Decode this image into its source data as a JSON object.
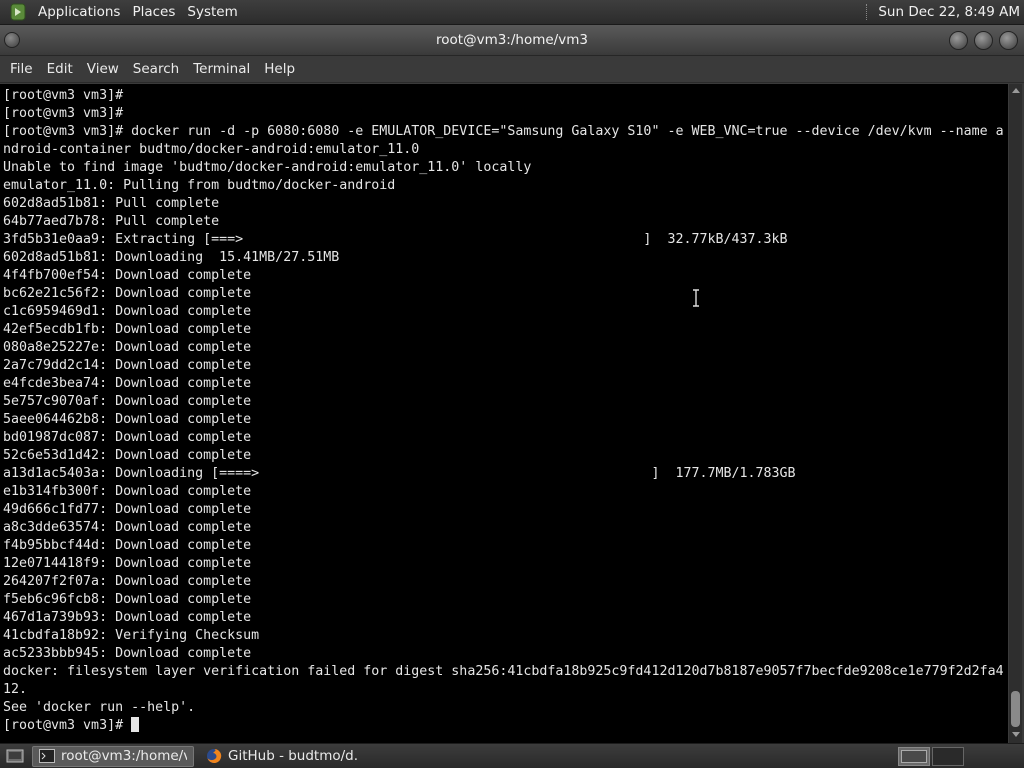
{
  "top_panel": {
    "menus": [
      "Applications",
      "Places",
      "System"
    ],
    "clock": "Sun Dec 22,  8:49 AM"
  },
  "window": {
    "title": "root@vm3:/home/vm3"
  },
  "menubar": [
    "File",
    "Edit",
    "View",
    "Search",
    "Terminal",
    "Help"
  ],
  "terminal": {
    "lines": [
      "[root@vm3 vm3]#",
      "[root@vm3 vm3]#",
      "[root@vm3 vm3]# docker run -d -p 6080:6080 -e EMULATOR_DEVICE=\"Samsung Galaxy S10\" -e WEB_VNC=true --device /dev/kvm --name a",
      "ndroid-container budtmo/docker-android:emulator_11.0",
      "Unable to find image 'budtmo/docker-android:emulator_11.0' locally",
      "emulator_11.0: Pulling from budtmo/docker-android",
      "602d8ad51b81: Pull complete",
      "64b77aed7b78: Pull complete",
      "3fd5b31e0aa9: Extracting [===>                                                  ]  32.77kB/437.3kB",
      "602d8ad51b81: Downloading  15.41MB/27.51MB",
      "4f4fb700ef54: Download complete",
      "bc62e21c56f2: Download complete",
      "c1c6959469d1: Download complete",
      "42ef5ecdb1fb: Download complete",
      "080a8e25227e: Download complete",
      "2a7c79dd2c14: Download complete",
      "e4fcde3bea74: Download complete",
      "5e757c9070af: Download complete",
      "5aee064462b8: Download complete",
      "bd01987dc087: Download complete",
      "52c6e53d1d42: Download complete",
      "a13d1ac5403a: Downloading [====>                                                 ]  177.7MB/1.783GB",
      "e1b314fb300f: Download complete",
      "49d666c1fd77: Download complete",
      "a8c3dde63574: Download complete",
      "f4b95bbcf44d: Download complete",
      "12e0714418f9: Download complete",
      "264207f2f07a: Download complete",
      "f5eb6c96fcb8: Download complete",
      "467d1a739b93: Download complete",
      "41cbdfa18b92: Verifying Checksum",
      "ac5233bbb945: Download complete",
      "docker: filesystem layer verification failed for digest sha256:41cbdfa18b925c9fd412d120d7b8187e9057f7becfde9208ce1e779f2d2fa4",
      "12.",
      "See 'docker run --help'."
    ],
    "prompt": "[root@vm3 vm3]# "
  },
  "taskbar": {
    "tasks": [
      {
        "label": "root@vm3:/home/v...",
        "active": true
      },
      {
        "label": "GitHub - budtmo/d...",
        "active": false
      }
    ]
  }
}
